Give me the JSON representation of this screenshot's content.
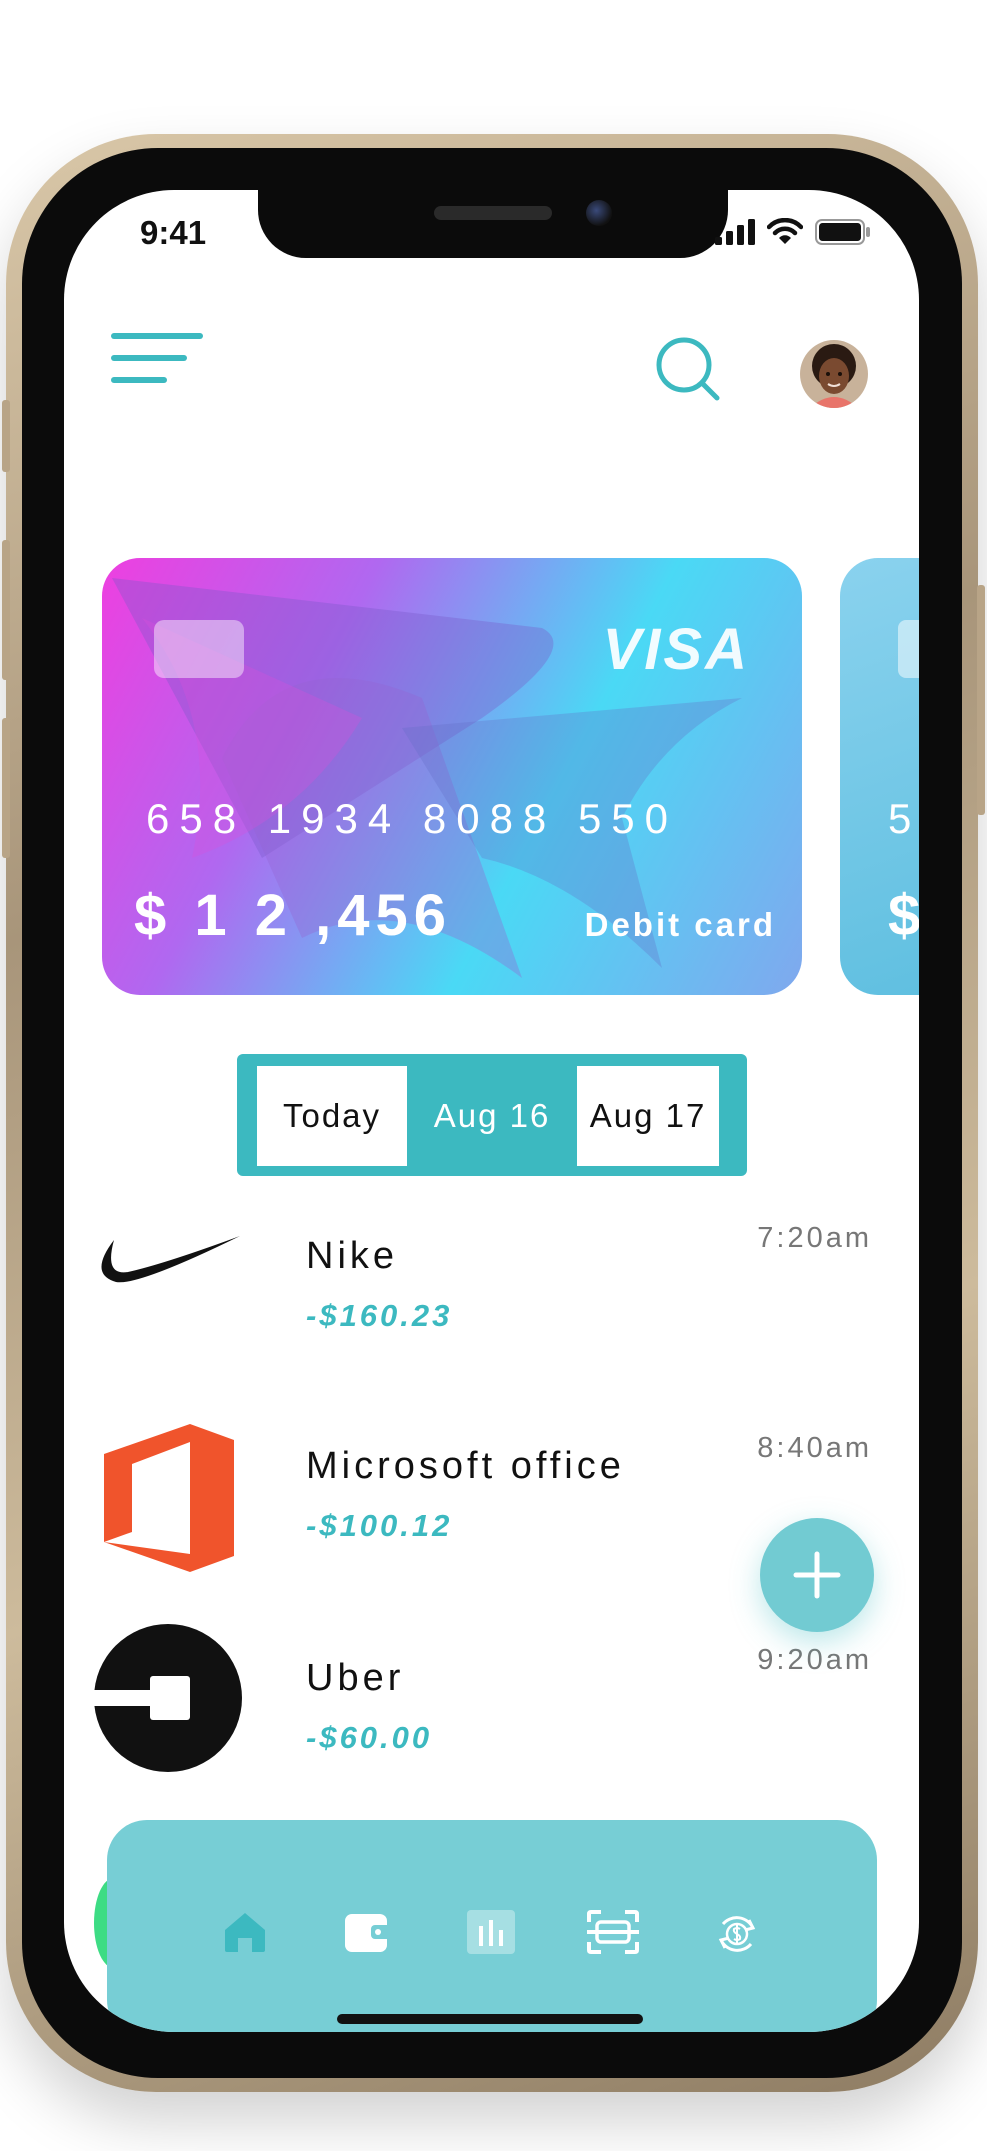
{
  "status_bar": {
    "time": "9:41"
  },
  "card": {
    "brand": "VISA",
    "number": "658 1934 8088 550",
    "balance": "$ 1 2 ,456",
    "type": "Debit card"
  },
  "card_peek": {
    "number_fragment": "5",
    "balance_fragment": "$"
  },
  "date_tabs": [
    {
      "label": "Today",
      "active": false
    },
    {
      "label": "Aug 16",
      "active": true
    },
    {
      "label": "Aug 17",
      "active": false
    }
  ],
  "transactions": [
    {
      "name": "Nike",
      "amount": "-$160.23",
      "time": "7:20am",
      "logo": "nike-swoosh-icon"
    },
    {
      "name": "Microsoft office",
      "amount": "-$100.12",
      "time": "8:40am",
      "logo": "microsoft-office-icon"
    },
    {
      "name": "Uber",
      "amount": "-$60.00",
      "time": "9:20am",
      "logo": "uber-icon"
    }
  ],
  "bottom_nav": [
    "home-icon",
    "wallet-icon",
    "stats-icon",
    "scan-icon",
    "exchange-icon"
  ],
  "colors": {
    "accent": "#3cb9c0",
    "nav": "#77ced5",
    "fab": "#72cbd2"
  }
}
